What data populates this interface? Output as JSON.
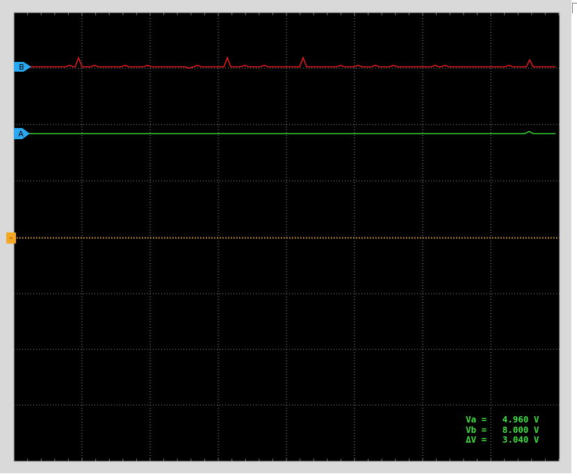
{
  "channels": {
    "a": {
      "label": "A",
      "color": "#2fd42f"
    },
    "b": {
      "label": "B",
      "color": "#e01b1b"
    }
  },
  "marker_color": "#2aa8f2",
  "trigger_color": "#f5a623",
  "grid_color": "#9a9a9a",
  "cursor_readout": {
    "va": "Va =   4.960 V",
    "vb": "Vb =   8.000 V",
    "dv": "ΔV =   3.040 V"
  }
}
